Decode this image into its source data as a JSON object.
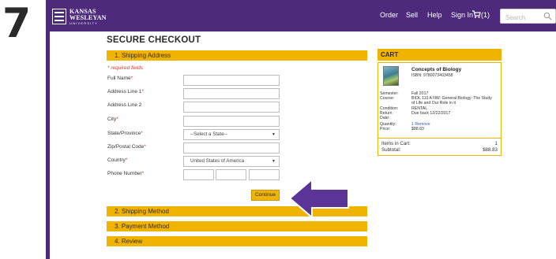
{
  "step": "7",
  "brand": {
    "line1": "KANSAS",
    "line2": "WESLEYAN",
    "line3": "UNIVERSITY"
  },
  "nav": {
    "order": "Order",
    "sell": "Sell",
    "help": "Help",
    "sign_in": "Sign In",
    "cart_count": "(1)",
    "search_placeholder": "Search"
  },
  "checkout": {
    "title": "SECURE CHECKOUT",
    "sections": {
      "shipping_address": "1. Shipping Address",
      "shipping_method": "2. Shipping Method",
      "payment_method": "3. Payment Method",
      "review": "4. Review"
    },
    "required_note": "* required fields",
    "fields": {
      "full_name": "Full Name",
      "address1": "Address Line 1",
      "address2": "Address Line 2",
      "city": "City",
      "state": "State/Province",
      "zip": "Zip/Postal Code",
      "country": "Country",
      "phone": "Phone Number"
    },
    "required_mark": "*",
    "state_select": "--Select a State--",
    "country_select": "United States of America",
    "continue_label": "Continue"
  },
  "cart": {
    "header": "CART",
    "book_title": "Concepts of Biology",
    "isbn": "ISBN: 9780073403458",
    "labels": {
      "semester": "Semester:",
      "course": "Course:",
      "condition": "Condition:",
      "return1": "Return",
      "return2": "Date:",
      "quantity": "Quantity:",
      "price": "Price:"
    },
    "values": {
      "semester": "Fall 2017",
      "course1": "BIOL 110 A NW: General Biology: The Study",
      "course2": "of Life and Our Role in it",
      "condition": "RENTAL",
      "return": "Due back 12/22/2017",
      "quantity": "1",
      "remove": "Remove",
      "price": "$88.83"
    },
    "items_label": "Items in Cart:",
    "items_value": "1",
    "subtotal_label": "Subtotal:",
    "subtotal_value": "$88.83"
  },
  "colors": {
    "purple": "#4d2a7c",
    "gold": "#f0b400",
    "arrow": "#5b3497"
  }
}
